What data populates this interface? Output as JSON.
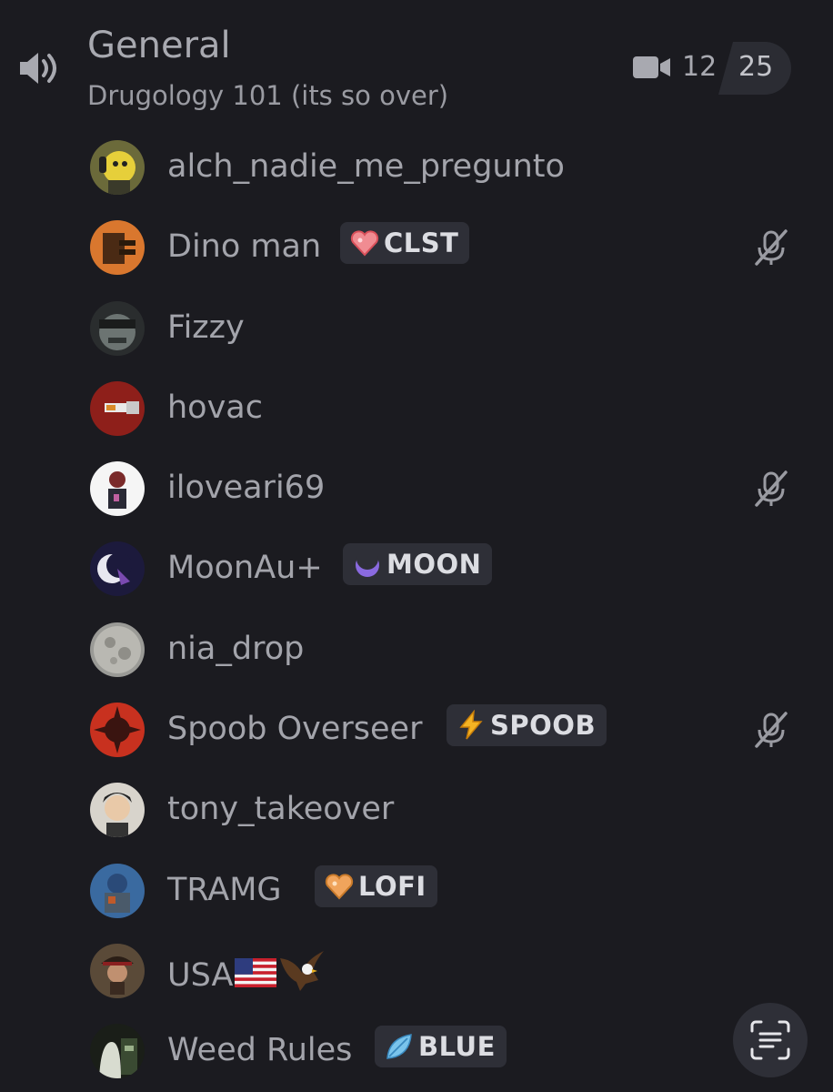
{
  "channel": {
    "name": "General",
    "status": "Drugology 101 (its so over)",
    "icon": "speaker-icon",
    "camera_icon": "video-camera-icon",
    "user_count": "12",
    "user_limit": "25"
  },
  "members": [
    {
      "name": "alch_nadie_me_pregunto",
      "muted": false
    },
    {
      "name": "Dino man",
      "tag": "CLST",
      "tag_icon": "pink-heart-icon",
      "muted": true
    },
    {
      "name": "Fizzy",
      "muted": false
    },
    {
      "name": "hovac",
      "muted": false
    },
    {
      "name": "iloveari69",
      "muted": true
    },
    {
      "name": "MoonAu+",
      "tag": "MOON",
      "tag_icon": "crescent-moon-icon",
      "muted": false
    },
    {
      "name": "nia_drop",
      "muted": false
    },
    {
      "name": "Spoob Overseer",
      "tag": "SPOOB",
      "tag_icon": "lightning-bolt-icon",
      "muted": true
    },
    {
      "name": "tony_takeover",
      "muted": false
    },
    {
      "name": "TRAMG",
      "tag": "LOFI",
      "tag_icon": "orange-heart-icon",
      "muted": false
    },
    {
      "name": "USA",
      "emoji": [
        "us-flag-icon",
        "eagle-icon"
      ],
      "muted": false
    },
    {
      "name": "Weed Rules",
      "tag": "BLUE",
      "tag_icon": "blue-leaf-icon",
      "muted": false
    }
  ],
  "colors": {
    "background": "#1b1b20",
    "tag_background": "#2e2f37",
    "text": "#a3a4ab"
  },
  "scan_button_icon": "scan-text-icon"
}
